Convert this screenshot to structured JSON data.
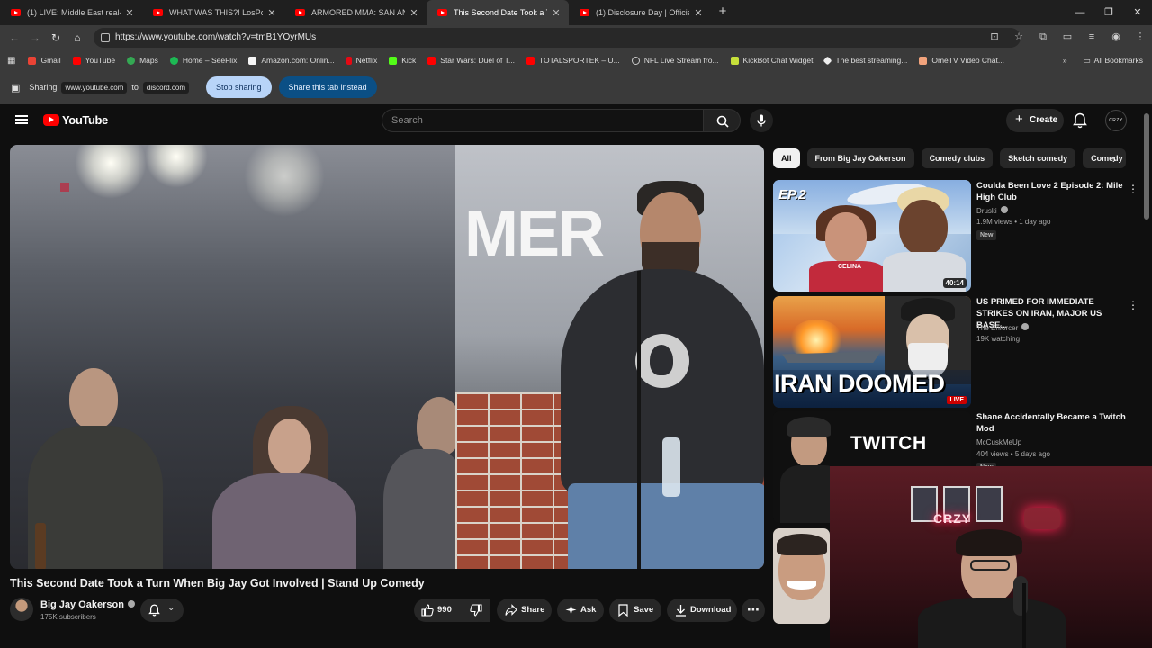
{
  "browser": {
    "tabs": [
      {
        "title": "(1) LIVE: Middle East real-ti",
        "active": false
      },
      {
        "title": "WHAT WAS THIS?! LosPollosTV",
        "active": false
      },
      {
        "title": "ARMORED MMA: SAN ANTONI",
        "active": false
      },
      {
        "title": "This Second Date Took a Turn V",
        "active": true
      },
      {
        "title": "(1) Disclosure Day | Official Tea",
        "active": false
      }
    ],
    "url": "https://www.youtube.com/watch?v=tmB1YOyrMUs",
    "bookmarks": [
      "Gmail",
      "YouTube",
      "Maps",
      "Home – SeeFlix",
      "Amazon.com: Onlin...",
      "Netflix",
      "Kick",
      "Star Wars: Duel of T...",
      "TOTALSPORTEK – U...",
      "NFL Live Stream fro...",
      "KickBot Chat Widget",
      "The best streaming...",
      "OmeTV Video Chat..."
    ],
    "all_bookmarks": "All Bookmarks",
    "sharing": {
      "label": "Sharing",
      "source": "www.youtube.com",
      "to": "to",
      "target": "discord.com",
      "stop": "Stop sharing",
      "share_tab": "Share this tab instead"
    }
  },
  "youtube": {
    "logo_text": "YouTube",
    "search_placeholder": "Search",
    "create_label": "Create",
    "avatar_text": "CRZY",
    "video": {
      "title": "This Second Date Took a Turn When Big Jay Got Involved | Stand Up Comedy",
      "channel": "Big Jay Oakerson",
      "subscribers": "175K subscribers",
      "likes": "990",
      "share": "Share",
      "ask": "Ask",
      "save": "Save",
      "download": "Download",
      "mural_text": "MER"
    },
    "chips": [
      "All",
      "From Big Jay Oakerson",
      "Comedy clubs",
      "Sketch comedy",
      "Comedy"
    ],
    "recommendations": [
      {
        "title": "Coulda Been Love 2 Episode 2: Mile High Club",
        "channel": "Druski",
        "meta": "1.9M views • 1 day ago",
        "tag": "New",
        "duration": "40:14",
        "thumb_text": "EP.2",
        "thumb_sub": "CELINA"
      },
      {
        "title": "US PRIMED FOR IMMEDIATE STRIKES ON IRAN, MAJOR US BASE...",
        "channel": "The Enforcer",
        "meta": "19K watching",
        "tag": "",
        "duration": "LIVE",
        "thumb_text": "IRAN DOOMED"
      },
      {
        "title": "Shane Accidentally Became a Twitch Mod",
        "channel": "McCuskMeUp",
        "meta": "404 views • 5 days ago",
        "tag": "New",
        "duration": "",
        "thumb_text": "TWITCH"
      }
    ]
  },
  "webcam": {
    "neon_text": "CRZY"
  }
}
